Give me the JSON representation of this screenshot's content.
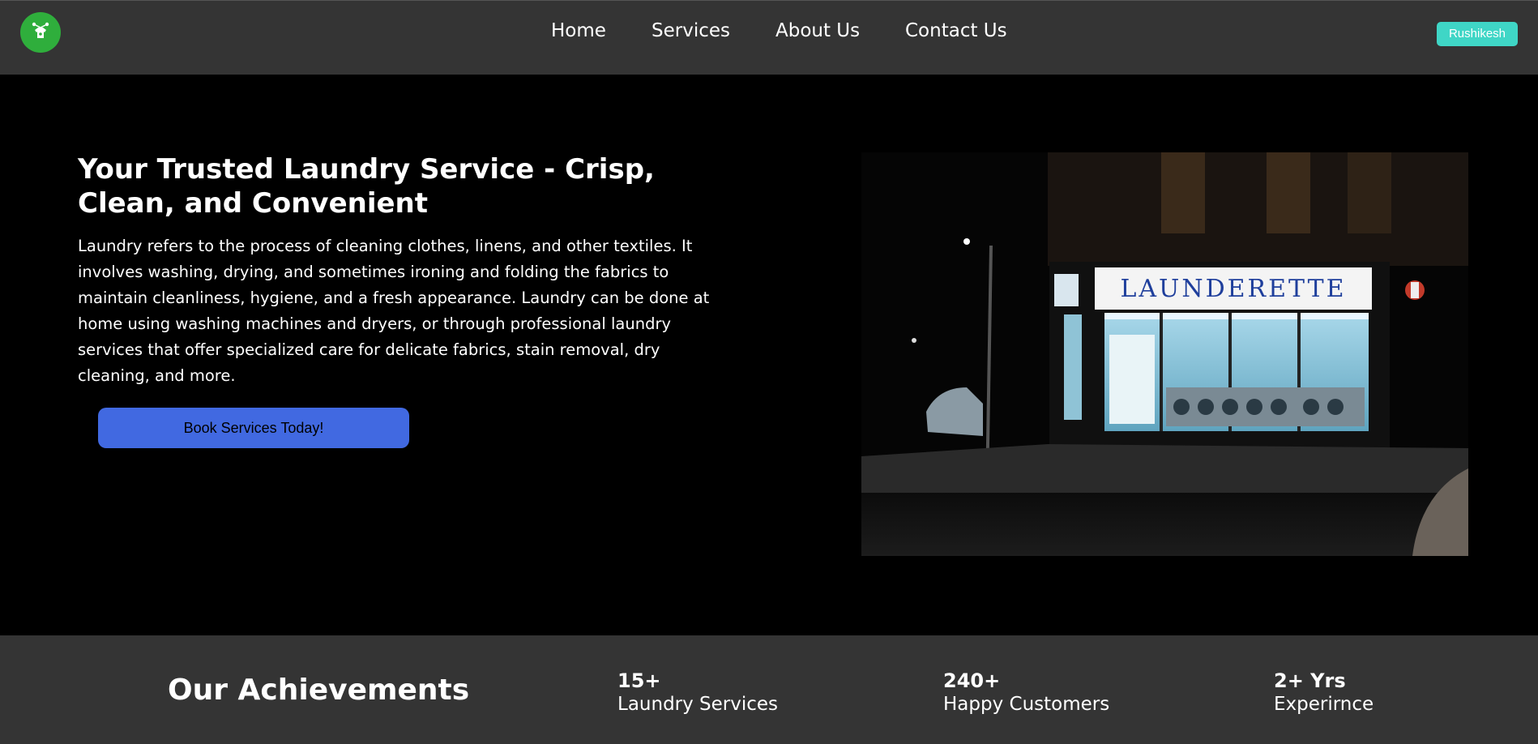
{
  "nav": {
    "logo_icon": "laundry-tshirt-icon",
    "links": [
      "Home",
      "Services",
      "About Us",
      "Contact Us"
    ],
    "user_label": "Rushikesh"
  },
  "hero": {
    "title": "Your Trusted Laundry Service - Crisp, Clean, and Convenient",
    "description": "Laundry refers to the process of cleaning clothes, linens, and other textiles. It involves washing, drying, and sometimes ironing and folding the fabrics to maintain cleanliness, hygiene, and a fresh appearance. Laundry can be done at home using washing machines and dryers, or through professional laundry services that offer specialized care for delicate fabrics, stain removal, dry cleaning, and more.",
    "cta_label": "Book Services Today!",
    "photo_sign_text": "LAUNDERETTE"
  },
  "achievements": {
    "title": "Our Achievements",
    "stats": [
      {
        "value": "15+",
        "label": "Laundry Services"
      },
      {
        "value": "240+",
        "label": "Happy Customers"
      },
      {
        "value": "2+ Yrs",
        "label": "Experirnce"
      }
    ]
  },
  "colors": {
    "nav_bg": "#343434",
    "logo_bg": "#2fae3c",
    "user_button": "#3fd6c6",
    "cta_button": "#4169e1",
    "hero_bg": "#000000"
  }
}
